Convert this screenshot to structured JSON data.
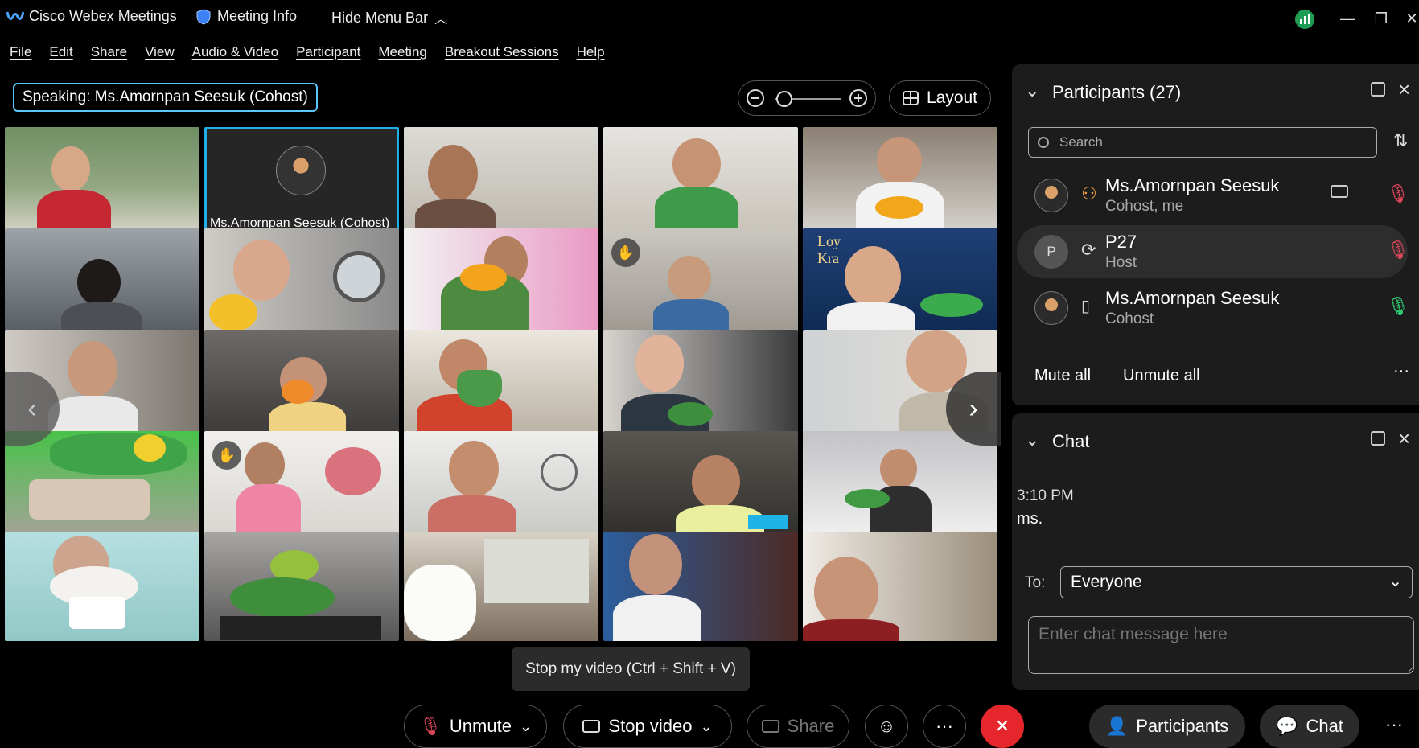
{
  "titlebar": {
    "app_name": "Cisco Webex Meetings",
    "meeting_info": "Meeting Info",
    "hide_menu": "Hide Menu Bar",
    "minimize": "—",
    "restore": "❐",
    "close": "✕"
  },
  "menu": [
    "File",
    "Edit",
    "Share",
    "View",
    "Audio & Video",
    "Participant",
    "Meeting",
    "Breakout Sessions",
    "Help"
  ],
  "speaking": {
    "label": "Speaking:",
    "name": "Ms.Amornpan Seesuk (Cohost)"
  },
  "layout_label": "Layout",
  "zoom_level": 0.1,
  "active_tile_name": "Ms.Amornpan Seesuk  (Cohost)",
  "tooltip": "Stop my video (Ctrl + Shift + V)",
  "participants_panel": {
    "title": "Participants (27)",
    "search_placeholder": "Search",
    "rows": [
      {
        "name": "Ms.Amornpan Seesuk",
        "role": "Cohost, me",
        "initial": ""
      },
      {
        "name": "P27",
        "role": "Host",
        "initial": "P"
      },
      {
        "name": "Ms.Amornpan Seesuk",
        "role": "Cohost",
        "initial": ""
      }
    ],
    "mute_all": "Mute all",
    "unmute_all": "Unmute all",
    "more": "···"
  },
  "chat_panel": {
    "title": "Chat",
    "message_time": "3:10 PM",
    "message_text": "ms.",
    "to_label": "To:",
    "to_value": "Everyone",
    "input_placeholder": "Enter chat message here"
  },
  "toolbar": {
    "unmute": "Unmute",
    "stop_video": "Stop video",
    "share": "Share",
    "more": "···",
    "participants": "Participants",
    "chat": "Chat",
    "overflow": "···"
  },
  "colors": {
    "accent": "#5ac8fa",
    "end_call": "#e5262d",
    "mic_muted": "#e0465a",
    "mic_on": "#2ecc71"
  }
}
